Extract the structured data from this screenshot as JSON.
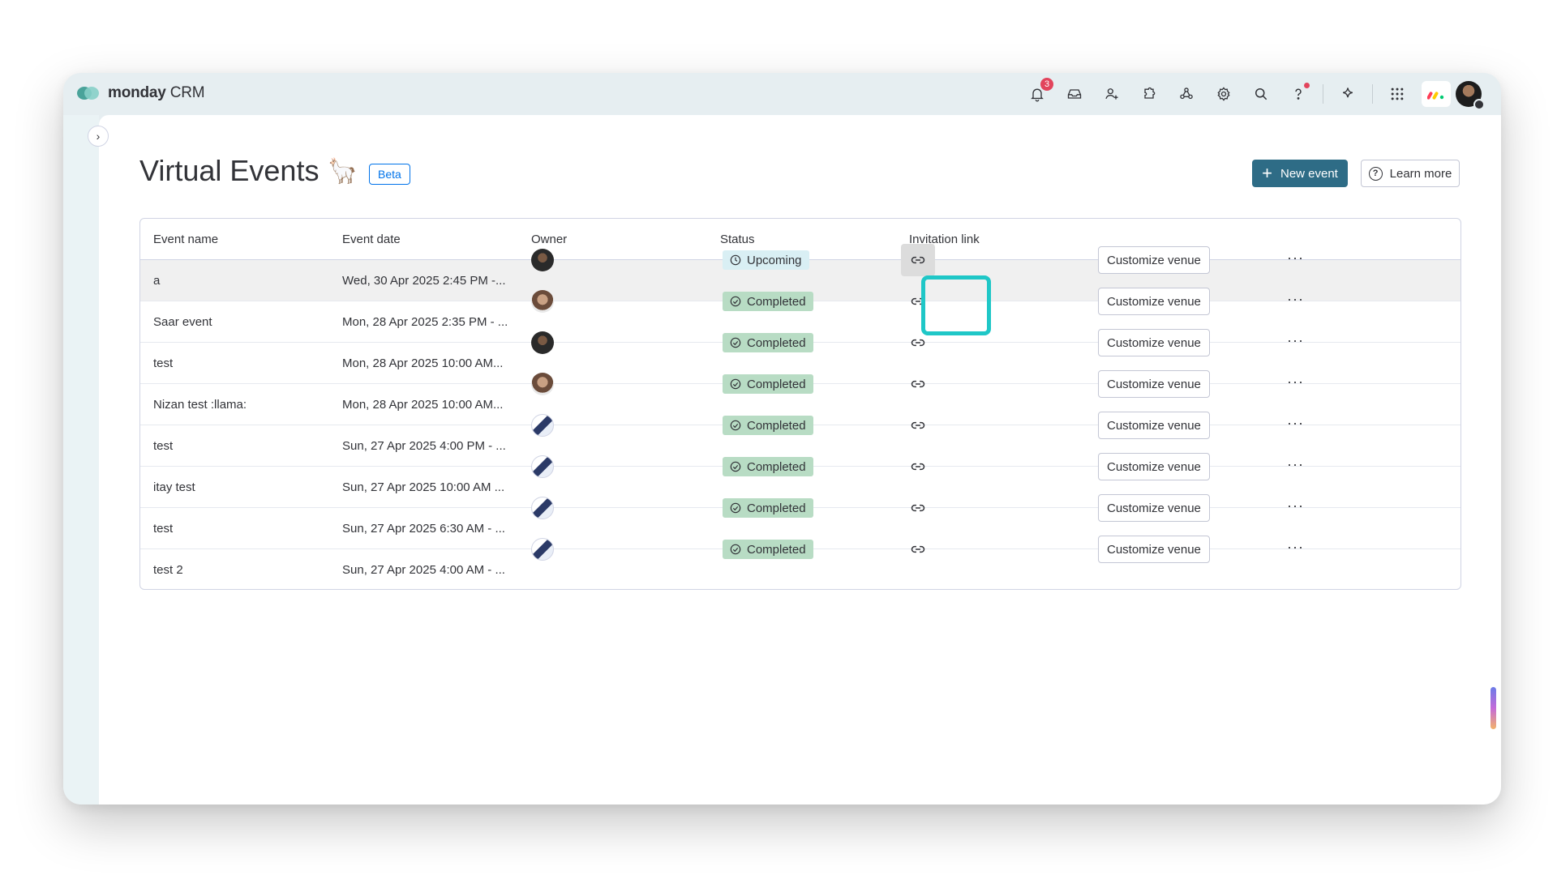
{
  "app": {
    "brand_bold": "monday",
    "brand_rest": " CRM"
  },
  "topbar": {
    "notifications_count": "3",
    "icons": [
      "bell-icon",
      "inbox-icon",
      "invite-member-icon",
      "apps-icon",
      "integrations-icon",
      "settings-icon",
      "search-icon",
      "help-icon",
      "ai-sparkle-icon",
      "app-grid-icon"
    ]
  },
  "page": {
    "title": "Virtual Events",
    "title_emoji": "🦙",
    "beta_label": "Beta",
    "new_event_label": "New event",
    "learn_more_label": "Learn more"
  },
  "table": {
    "columns": [
      "Event name",
      "Event date",
      "Owner",
      "Status",
      "Invitation link"
    ],
    "customize_label": "Customize venue",
    "more_label": "···",
    "rows": [
      {
        "name": "a",
        "date": "Wed, 30 Apr 2025 2:45 PM -...",
        "owner": "av1",
        "status": "Upcoming"
      },
      {
        "name": "Saar event",
        "date": "Mon, 28 Apr 2025 2:35 PM - ...",
        "owner": "av2",
        "status": "Completed"
      },
      {
        "name": "test",
        "date": "Mon, 28 Apr 2025 10:00 AM...",
        "owner": "av1",
        "status": "Completed"
      },
      {
        "name": "Nizan test :llama:",
        "date": "Mon, 28 Apr 2025 10:00 AM...",
        "owner": "av2",
        "status": "Completed"
      },
      {
        "name": "test",
        "date": "Sun, 27 Apr 2025 4:00 PM - ...",
        "owner": "av3",
        "status": "Completed"
      },
      {
        "name": "itay test",
        "date": "Sun, 27 Apr 2025 10:00 AM ...",
        "owner": "av3",
        "status": "Completed"
      },
      {
        "name": "test",
        "date": "Sun, 27 Apr 2025 6:30 AM - ...",
        "owner": "av3",
        "status": "Completed"
      },
      {
        "name": "test 2",
        "date": "Sun, 27 Apr 2025 4:00 AM - ...",
        "owner": "av3",
        "status": "Completed"
      }
    ]
  },
  "colors": {
    "accent": "#2e6c86",
    "highlight_ring": "#1fc7c7",
    "completed": "#b8dcc4",
    "upcoming": "#d9eff4"
  }
}
